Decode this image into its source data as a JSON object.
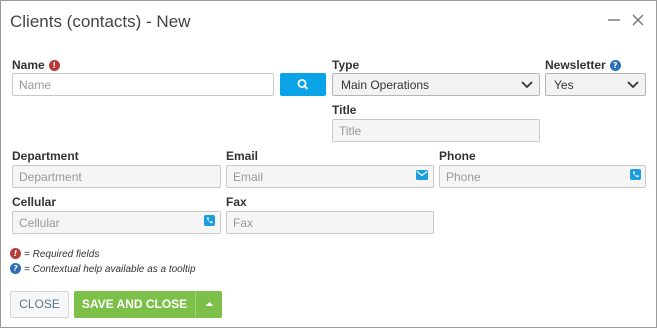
{
  "dialog": {
    "title": "Clients (contacts) - New",
    "minimize_icon": "minimize-icon",
    "close_icon": "close-icon"
  },
  "form": {
    "name": {
      "label": "Name",
      "placeholder": "Name",
      "required": true
    },
    "search_button_icon": "search-icon",
    "type": {
      "label": "Type",
      "value": "Main Operations"
    },
    "newsletter": {
      "label": "Newsletter",
      "value": "Yes",
      "help": true
    },
    "title": {
      "label": "Title",
      "placeholder": "Title"
    },
    "department": {
      "label": "Department",
      "placeholder": "Department"
    },
    "email": {
      "label": "Email",
      "placeholder": "Email",
      "icon": "envelope-icon"
    },
    "phone": {
      "label": "Phone",
      "placeholder": "Phone",
      "icon": "phone-icon"
    },
    "cellular": {
      "label": "Cellular",
      "placeholder": "Cellular",
      "icon": "phone-icon"
    },
    "fax": {
      "label": "Fax",
      "placeholder": "Fax"
    }
  },
  "legend": {
    "required_text": "= Required fields",
    "help_text": "= Contextual help available as a tooltip"
  },
  "footer": {
    "close_label": "CLOSE",
    "save_label": "SAVE AND CLOSE",
    "split_icon": "caret-up-icon"
  },
  "colors": {
    "accent_blue": "#0ba3e8",
    "save_green": "#7cc04a",
    "required_red": "#b83b3b",
    "help_blue": "#2d6fb7"
  }
}
